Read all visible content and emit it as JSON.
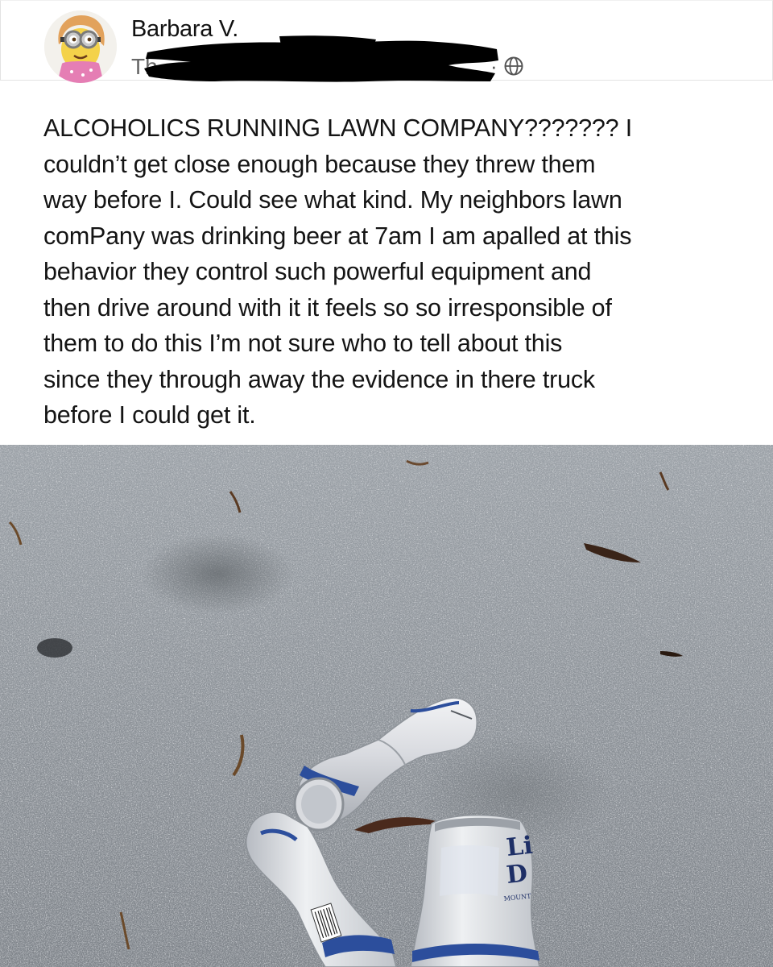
{
  "post": {
    "author_name": "Barbara V.",
    "meta_prefix": "Th",
    "meta_separator": "·",
    "visibility_icon": "globe-icon",
    "body": "ALCOHOLICS RUNNING LAWN COMPANY??????? I\ncouldn’t get close enough because they threw them\nway before I. Could see what kind. My neighbors lawn\ncomPany was drinking beer at 7am I am apalled at this\nbehavior they control such powerful equipment and\nthen drive around with it it feels so so irresponsible of\nthem to do this I’m not sure who to tell about this\nsince they through away the evidence in there truck\nbefore I could get it.",
    "photo": {
      "subject": "three crushed beer cans on a concrete driveway",
      "can_label_text": [
        "Li",
        "D",
        "MOUNT"
      ]
    }
  },
  "colors": {
    "background": "#ffffff",
    "text": "#141414",
    "redaction": "#000000",
    "concrete": "#8e9398",
    "can_blue": "#2c4e9c"
  }
}
